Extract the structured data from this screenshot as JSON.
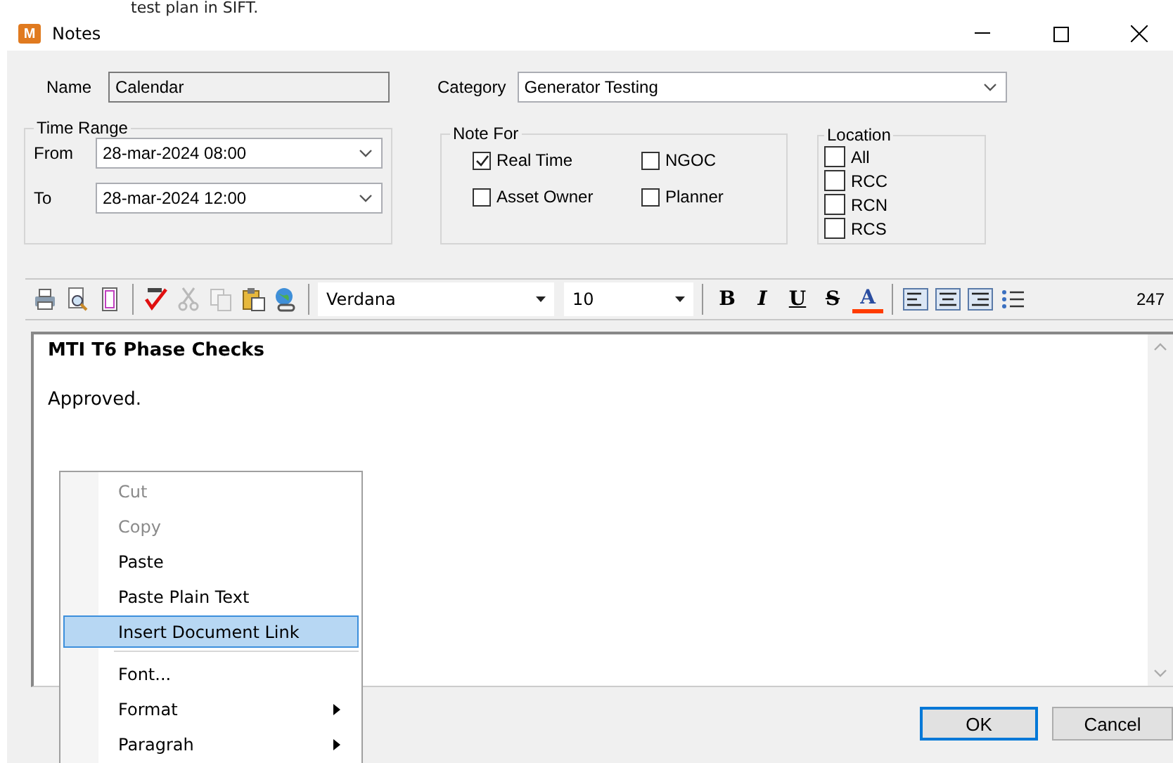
{
  "background_text": "test plan in SIFT.",
  "window": {
    "icon_letter": "M",
    "title": "Notes"
  },
  "name": {
    "label": "Name",
    "value": "Calendar"
  },
  "category": {
    "label": "Category",
    "value": "Generator Testing"
  },
  "time_range": {
    "title": "Time Range",
    "rows": [
      {
        "label": "From",
        "value": "28-mar-2024 08:00"
      },
      {
        "label": "To",
        "value": "28-mar-2024 12:00"
      }
    ]
  },
  "note_for": {
    "title": "Note For",
    "options": [
      {
        "label": "Real Time",
        "checked": true
      },
      {
        "label": "NGOC",
        "checked": false
      },
      {
        "label": "Asset Owner",
        "checked": false
      },
      {
        "label": "Planner",
        "checked": false
      }
    ]
  },
  "location": {
    "title": "Location",
    "options": [
      {
        "label": "All",
        "checked": false
      },
      {
        "label": "RCC",
        "checked": false
      },
      {
        "label": "RCN",
        "checked": false
      },
      {
        "label": "RCS",
        "checked": false
      }
    ]
  },
  "toolbar": {
    "tools": [
      {
        "kind": "print",
        "disabled": false
      },
      {
        "kind": "preview",
        "disabled": false
      },
      {
        "kind": "page",
        "disabled": false
      },
      {
        "kind": "spell",
        "disabled": false
      },
      {
        "kind": "cut",
        "disabled": true
      },
      {
        "kind": "copy",
        "disabled": true
      },
      {
        "kind": "paste",
        "disabled": false
      },
      {
        "kind": "link",
        "disabled": false
      }
    ],
    "font": "Verdana",
    "size": "10",
    "formats": [
      {
        "kind": "bold",
        "glyph": "B"
      },
      {
        "kind": "italic",
        "glyph": "I"
      },
      {
        "kind": "underline",
        "glyph": "U"
      },
      {
        "kind": "strike",
        "glyph": "S"
      },
      {
        "kind": "color",
        "glyph": "A"
      }
    ],
    "aligns": [
      {
        "kind": "left"
      },
      {
        "kind": "center"
      },
      {
        "kind": "right"
      },
      {
        "kind": "bullets"
      }
    ],
    "count": "247"
  },
  "editor": {
    "heading": "MTI T6 Phase Checks",
    "body": "Approved."
  },
  "context_menu": {
    "items": [
      {
        "kind": "item",
        "label": "Cut",
        "disabled": true,
        "selected": false,
        "submenu": false
      },
      {
        "kind": "item",
        "label": "Copy",
        "disabled": true,
        "selected": false,
        "submenu": false
      },
      {
        "kind": "item",
        "label": "Paste",
        "disabled": false,
        "selected": false,
        "submenu": false
      },
      {
        "kind": "item",
        "label": "Paste Plain Text",
        "disabled": false,
        "selected": false,
        "submenu": false
      },
      {
        "kind": "item",
        "label": "Insert Document Link",
        "disabled": false,
        "selected": true,
        "submenu": false
      },
      {
        "kind": "separator"
      },
      {
        "kind": "item",
        "label": "Font...",
        "disabled": false,
        "selected": false,
        "submenu": false
      },
      {
        "kind": "item",
        "label": "Format",
        "disabled": false,
        "selected": false,
        "submenu": true
      },
      {
        "kind": "item",
        "label": "Paragrah",
        "disabled": false,
        "selected": false,
        "submenu": true
      }
    ]
  },
  "buttons": [
    {
      "label": "OK",
      "default": true
    },
    {
      "label": "Cancel",
      "default": false
    }
  ]
}
